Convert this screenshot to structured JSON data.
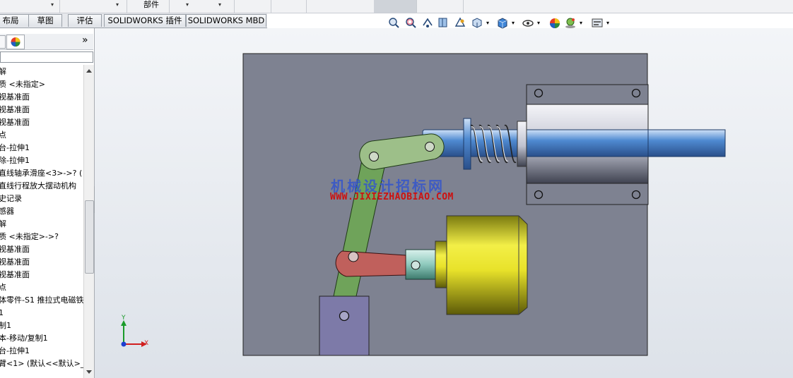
{
  "top_toolbar": {
    "dropdown_left_arrow": "▾",
    "dropdown_mid_arrow": "▾",
    "part_label": "部件",
    "part_arrow_1": "▾",
    "part_arrow_2": "▾"
  },
  "tabs": [
    {
      "label": "布局"
    },
    {
      "label": "草图"
    },
    {
      "label": "评估"
    },
    {
      "label": "SOLIDWORKS 插件"
    },
    {
      "label": "SOLIDWORKS MBD"
    }
  ],
  "panel": {
    "expand_chevron": "»"
  },
  "tree": {
    "items": [
      "解",
      "质 <未指定>",
      "视基准面",
      "视基准面",
      "视基准面",
      "点",
      "台-拉伸1",
      "除-拉伸1",
      "直线轴承滑座<3>->? (",
      " 直线行程放大摆动机构",
      "史记录",
      "感器",
      "解",
      "质 <未指定>->?",
      "视基准面",
      "视基准面",
      "视基准面",
      "点",
      "体零件-S1 推拉式电磁铁",
      "1",
      "制1",
      "本-移动/复制1",
      "台-拉伸1",
      "臂<1> (默认<<默认>_"
    ]
  },
  "triad": {
    "x_label": "X",
    "y_label": "Y"
  },
  "watermark": {
    "line1": "机械设计招标网",
    "line2": "WWW.JIXIEZHAOBIAO.COM"
  },
  "colors": {
    "plate": "#7e8291",
    "link_green": "#6fa35a",
    "crank_green": "#9dbf89",
    "arm_red": "#c0605c",
    "block_purple": "#7d7aa8",
    "solenoid_yellow": "#e8e22a",
    "shaft_blue": "#4f8ad1"
  },
  "hud_icons": [
    "zoom-to-fit-icon",
    "zoom-area-icon",
    "previous-view-icon",
    "section-view-icon",
    "dynamic-annotation-icon",
    "view-orientation-icon",
    "display-style-icon",
    "hide-show-items-icon",
    "edit-appearance-icon",
    "apply-scene-icon",
    "view-settings-icon"
  ]
}
